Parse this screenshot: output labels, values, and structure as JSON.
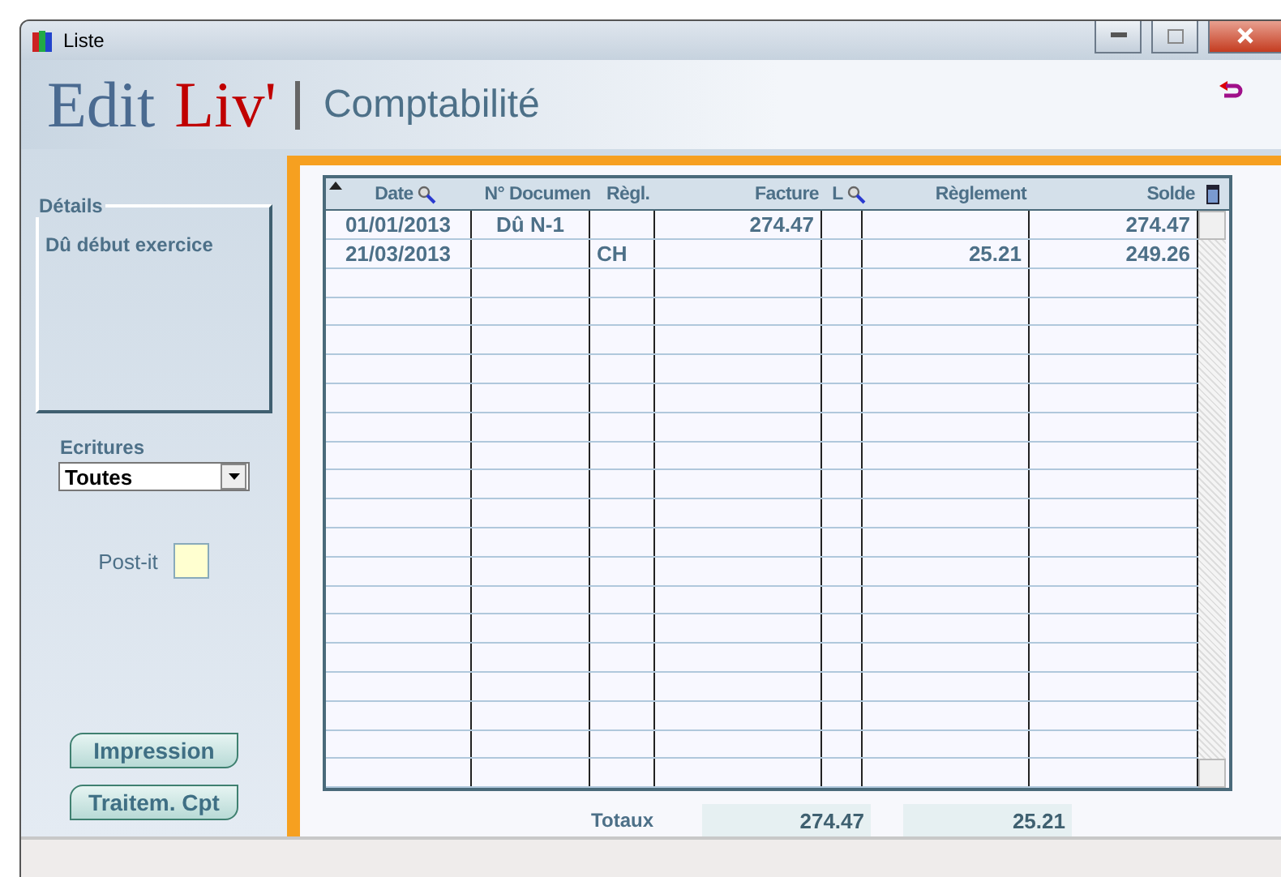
{
  "window": {
    "title": "Liste"
  },
  "header": {
    "logo_left": "Edit",
    "logo_right": "Liv'",
    "section": "Comptabilité"
  },
  "details": {
    "legend": "Détails",
    "text": "Dû début exercice"
  },
  "ecritures": {
    "label": "Ecritures",
    "value": "Toutes"
  },
  "postit": {
    "label": "Post-it"
  },
  "buttons": [
    {
      "label": "Impression"
    },
    {
      "label": "Traitem. Cpt"
    }
  ],
  "table": {
    "columns": [
      {
        "label": "Date",
        "search": true
      },
      {
        "label": "N° Documen",
        "search": false
      },
      {
        "label": "Règl.",
        "search": false
      },
      {
        "label": "Facture",
        "search": false
      },
      {
        "label": "L",
        "search": true
      },
      {
        "label": "Règlement",
        "search": false
      },
      {
        "label": "Solde",
        "search": false
      }
    ],
    "rows": [
      {
        "cells": [
          "01/01/2013",
          "Dû N-1",
          "",
          "274.47",
          "",
          "",
          "274.47"
        ]
      },
      {
        "cells": [
          "21/03/2013",
          "",
          "CH",
          "",
          "",
          "25.21",
          "249.26"
        ]
      }
    ]
  },
  "totals": {
    "label": "Totaux",
    "facture": "274.47",
    "reglement": "25.21"
  }
}
